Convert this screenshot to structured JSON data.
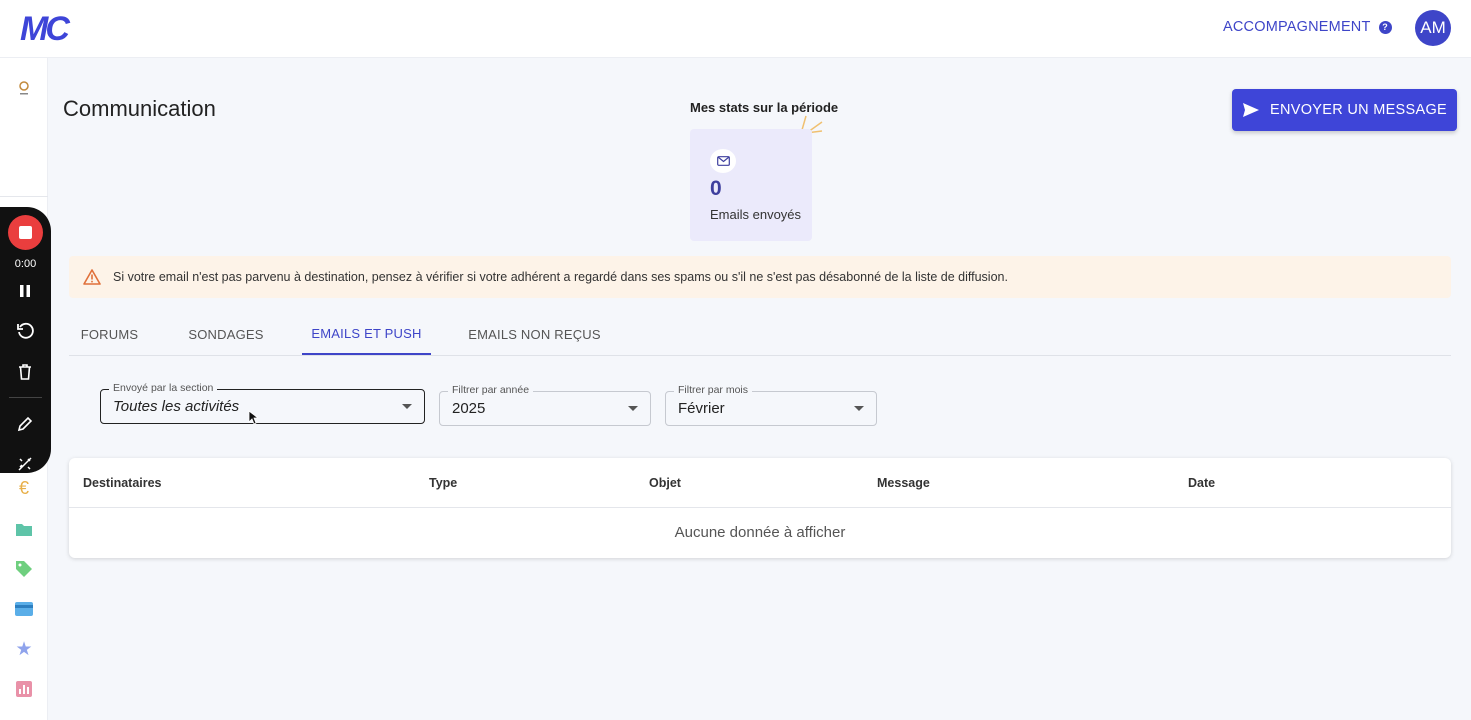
{
  "header": {
    "logo_text": "MC",
    "accompagnement_label": "ACCOMPAGNEMENT",
    "avatar_initials": "AM"
  },
  "recorder": {
    "time": "0:00"
  },
  "page": {
    "title": "Communication",
    "send_button_label": "ENVOYER UN MESSAGE"
  },
  "stats": {
    "heading": "Mes stats sur la période",
    "emails_sent_count": "0",
    "emails_sent_label": "Emails envoyés"
  },
  "alert": {
    "text": "Si votre email n'est pas parvenu à destination, pensez à vérifier si votre adhérent a regardé dans ses spams ou s'il ne s'est pas désabonné de la liste de diffusion."
  },
  "tabs": [
    {
      "label": "FORUMS",
      "active": false
    },
    {
      "label": "SONDAGES",
      "active": false
    },
    {
      "label": "EMAILS ET PUSH",
      "active": true
    },
    {
      "label": "EMAILS NON REÇUS",
      "active": false
    }
  ],
  "filters": {
    "section": {
      "label": "Envoyé par la section",
      "value": "Toutes les activités"
    },
    "year": {
      "label": "Filtrer par année",
      "value": "2025"
    },
    "month": {
      "label": "Filtrer par mois",
      "value": "Février"
    }
  },
  "table": {
    "columns": [
      "Destinataires",
      "Type",
      "Objet",
      "Message",
      "Date"
    ],
    "empty_message": "Aucune donnée à afficher"
  },
  "colors": {
    "accent": "#3e45c8",
    "recorder_stop": "#ea3e3e",
    "alert_bg": "#fdf3e8",
    "stats_card_bg": "#ebeafb"
  }
}
